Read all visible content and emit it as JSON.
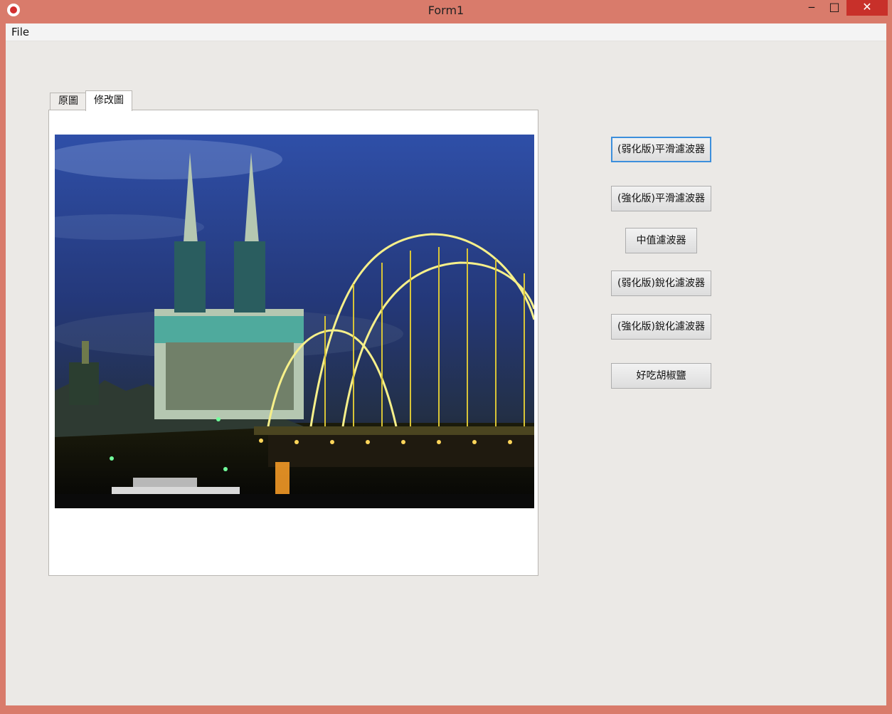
{
  "window": {
    "title": "Form1"
  },
  "controls": {
    "minimize": "‒",
    "maximize": "□",
    "close": "✕"
  },
  "menu": {
    "file": "File"
  },
  "tabs": [
    {
      "label": "原圖"
    },
    {
      "label": "修改圖"
    }
  ],
  "buttons": [
    {
      "label": "(弱化版)平滑濾波器"
    },
    {
      "label": "(強化版)平滑濾波器"
    },
    {
      "label": "中值濾波器"
    },
    {
      "label": "(弱化版)銳化濾波器"
    },
    {
      "label": "(強化版)銳化濾波器"
    },
    {
      "label": "好吃胡椒鹽"
    }
  ],
  "picture": {
    "subject": "night view of cathedral and arched bridge"
  }
}
